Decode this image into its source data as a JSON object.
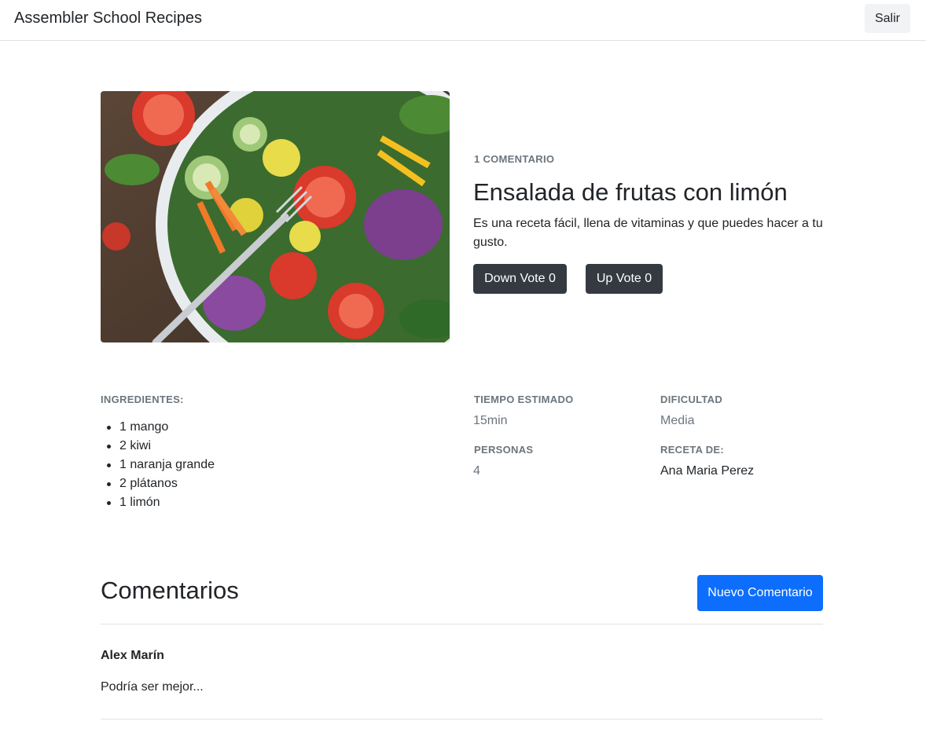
{
  "navbar": {
    "brand": "Assembler School Recipes",
    "logout_label": "Salir"
  },
  "recipe": {
    "image_name": "vegetable-salad-photo",
    "comment_count": "1 COMENTARIO",
    "title": "Ensalada de frutas con limón",
    "description": "Es una receta fácil, llena de vitaminas y que puedes hacer a tu gusto.",
    "down_vote_label": "Down Vote 0",
    "up_vote_label": "Up Vote 0"
  },
  "details": {
    "ingredients_label": "INGREDIENTES:",
    "ingredients": [
      "1 mango",
      "2 kiwi",
      "1 naranja grande",
      "2 plátanos",
      "1 limón"
    ],
    "time_label": "TIEMPO ESTIMADO",
    "time_value": "15min",
    "difficulty_label": "DIFICULTAD",
    "difficulty_value": "Media",
    "people_label": "PERSONAS",
    "people_value": "4",
    "author_label": "RECETA DE:",
    "author_value": "Ana Maria Perez"
  },
  "comments": {
    "heading": "Comentarios",
    "new_comment_label": "Nuevo Comentario",
    "items": [
      {
        "author": "Alex Marín",
        "text": "Podría ser mejor..."
      }
    ]
  },
  "colors": {
    "primary": "#0d6efd",
    "dark_button": "#343a40",
    "muted_text": "#6c757d"
  }
}
